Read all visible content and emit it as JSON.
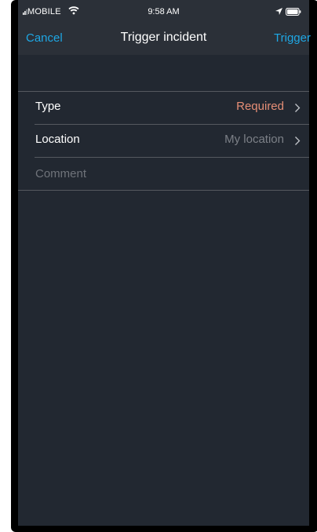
{
  "status_bar": {
    "carrier": "MOBILE",
    "time": "9:58 AM",
    "icons": [
      "signal-icon",
      "wifi-icon",
      "location-arrow-icon",
      "battery-icon"
    ]
  },
  "nav": {
    "cancel_label": "Cancel",
    "title": "Trigger incident",
    "trigger_label": "Trigger"
  },
  "form": {
    "type": {
      "label": "Type",
      "value": "Required"
    },
    "location": {
      "label": "Location",
      "value": "My location"
    },
    "comment": {
      "placeholder": "Comment",
      "value": ""
    }
  },
  "colors": {
    "accent": "#1ea7e4",
    "required": "#e58e76",
    "background": "#222831",
    "bar": "#2b3038",
    "separator": "#55595f"
  }
}
